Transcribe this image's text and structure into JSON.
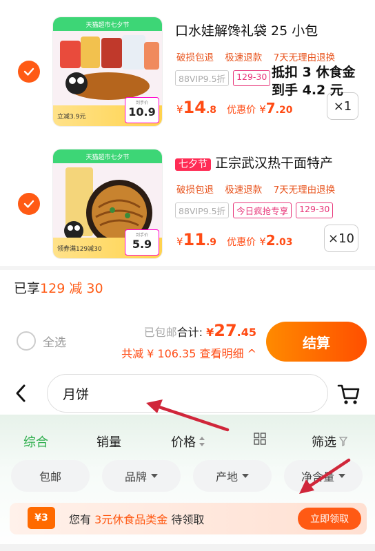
{
  "items": [
    {
      "title": "口水娃解馋礼袋 25 小包",
      "badge": "",
      "thumb_banner": "天猫超市七夕节",
      "thumb_foot": "立减3.9元",
      "thumb_price_label": "到手价",
      "thumb_price": "10.9",
      "tags": [
        "破损包退",
        "极速退款",
        "7天无理由退换"
      ],
      "promo_tags": [
        "88VIP9.5折",
        "129-30"
      ],
      "price_symbol": "¥",
      "price_int": "14",
      "price_dec": ".8",
      "after_label": "优惠价",
      "after_symbol": "¥",
      "after_int": "7",
      "after_dec": ".20",
      "qty": "×1"
    },
    {
      "title": "正宗武汉热干面特产",
      "badge": "七夕节",
      "thumb_banner": "天猫超市七夕节",
      "thumb_foot": "领券满129减30",
      "thumb_price_label": "到手价",
      "thumb_price": "5.9",
      "tags": [
        "破损包退",
        "极速退款",
        "7天无理由退换"
      ],
      "promo_tags": [
        "88VIP9.5折",
        "今日疯抢专享",
        "129-30"
      ],
      "price_symbol": "¥",
      "price_int": "11",
      "price_dec": ".9",
      "after_label": "优惠价",
      "after_symbol": "¥",
      "after_int": "2",
      "after_dec": ".03",
      "qty": "×10"
    }
  ],
  "annotation": {
    "line1": "抵扣 3 休食金",
    "line2": "到手 4.2 元"
  },
  "promo": {
    "prefix": "已享",
    "value": "129 减 30"
  },
  "summary": {
    "shipping": "已包邮",
    "total_label": "合计:",
    "total_symbol": "¥",
    "total_int": "27",
    "total_dec": ".45",
    "saved_label": "共减 ¥ 106.35",
    "detail_link": "查看明细 ^"
  },
  "select_all_label": "全选",
  "checkout_label": "结算",
  "search": {
    "value": "月饼"
  },
  "sort_tabs": [
    "综合",
    "销量",
    "价格",
    "筛选"
  ],
  "chips": [
    "包邮",
    "品牌",
    "产地",
    "净含量"
  ],
  "coupon": {
    "badge": "¥3",
    "text_prefix": "您有",
    "text_highlight": "3元休食品类金",
    "text_suffix": "待领取",
    "claim_label": "立即领取"
  },
  "colors": {
    "accent": "#ff5a14",
    "price": "#ff4b14",
    "green": "#2bad4a",
    "arrow": "#d0263a"
  }
}
